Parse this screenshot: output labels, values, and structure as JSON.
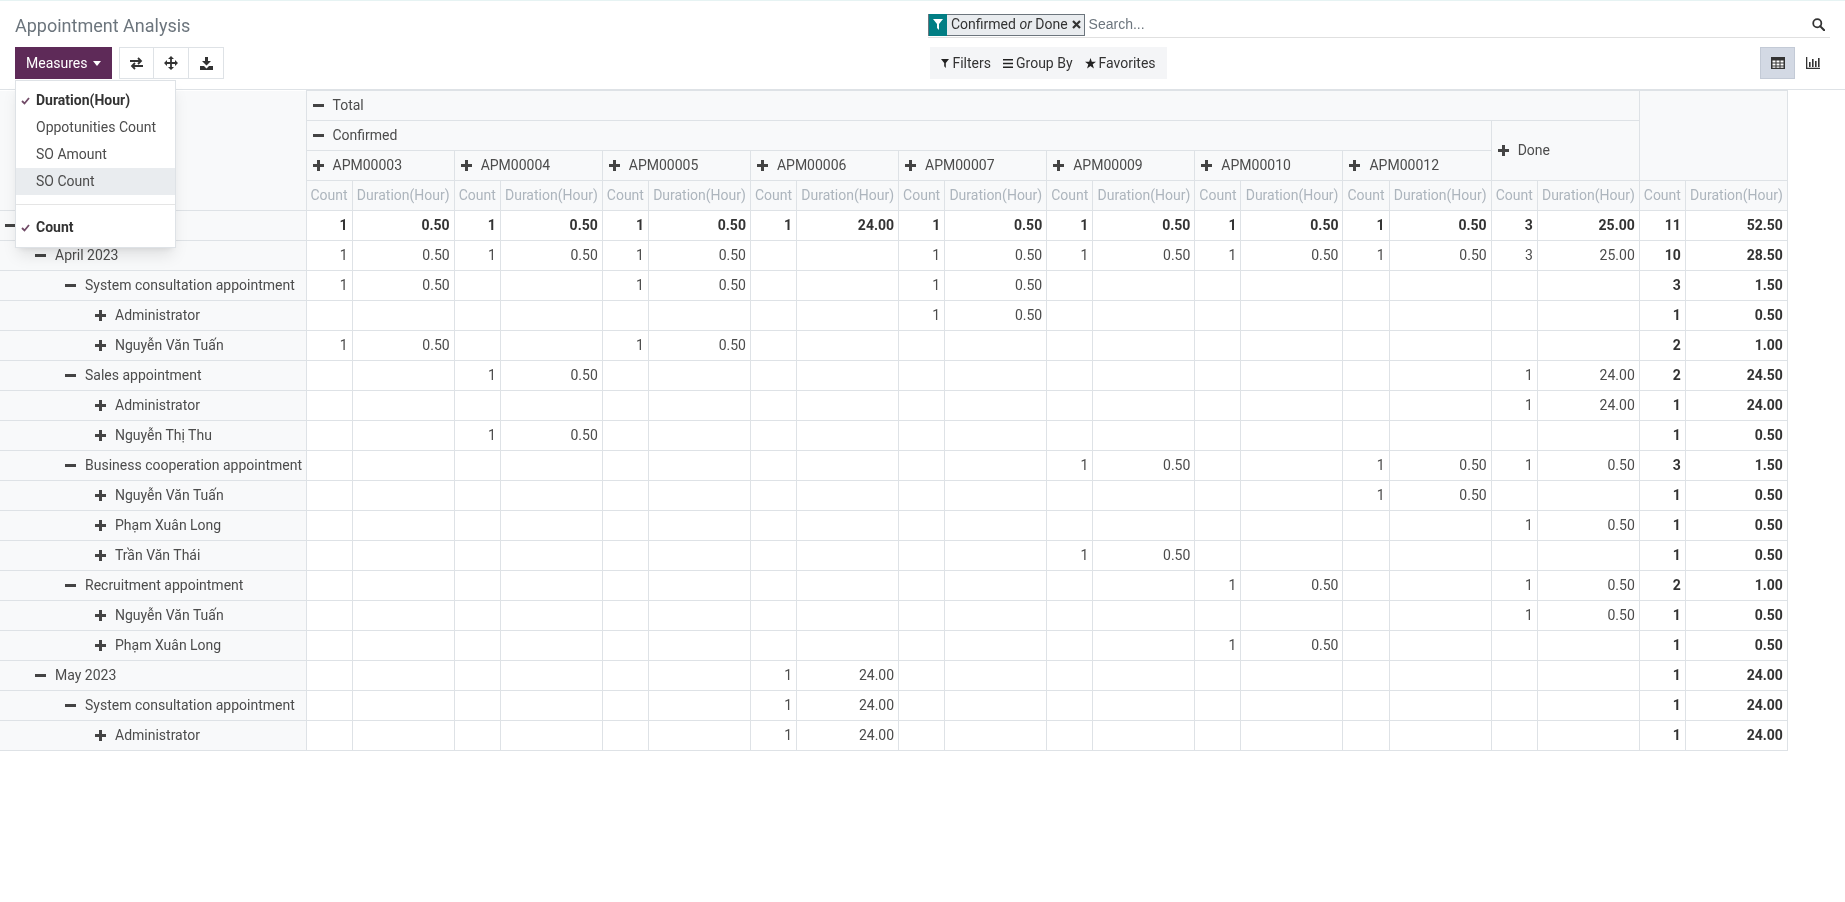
{
  "title": "Appointment Analysis",
  "toolbar": {
    "measures_button": "Measures"
  },
  "measures_menu": [
    {
      "label": "Duration(Hour)",
      "checked": true,
      "hovered": false
    },
    {
      "label": "Oppotunities Count",
      "checked": false,
      "hovered": false
    },
    {
      "label": "SO Amount",
      "checked": false,
      "hovered": false
    },
    {
      "label": "SO Count",
      "checked": false,
      "hovered": true
    },
    {
      "kind": "divider"
    },
    {
      "label": "Count",
      "checked": true,
      "hovered": false
    }
  ],
  "search": {
    "facet": {
      "parts": [
        "Confirmed",
        "or",
        "Done"
      ]
    },
    "placeholder": "Search..."
  },
  "search_options": [
    {
      "kind": "filter",
      "label": "Filters"
    },
    {
      "kind": "group",
      "label": "Group By"
    },
    {
      "kind": "favorite",
      "label": "Favorites"
    }
  ],
  "views": [
    {
      "kind": "pivot",
      "selected": true
    },
    {
      "kind": "graph",
      "selected": false
    }
  ],
  "table": {
    "columns": [
      {
        "label": "Total",
        "expanded": true,
        "children": [
          {
            "label": "Confirmed",
            "expanded": true,
            "children": [
              {
                "label": "APM00003",
                "expanded": false,
                "measures": [
                  "Count",
                  "Duration(Hour)"
                ]
              },
              {
                "label": "APM00004",
                "expanded": false,
                "measures": [
                  "Count",
                  "Duration(Hour)"
                ]
              },
              {
                "label": "APM00005",
                "expanded": false,
                "measures": [
                  "Count",
                  "Duration(Hour)"
                ]
              },
              {
                "label": "APM00006",
                "expanded": false,
                "measures": [
                  "Count",
                  "Duration(Hour)"
                ]
              },
              {
                "label": "APM00007",
                "expanded": false,
                "measures": [
                  "Count",
                  "Duration(Hour)"
                ]
              },
              {
                "label": "APM00009",
                "expanded": false,
                "measures": [
                  "Count",
                  "Duration(Hour)"
                ]
              },
              {
                "label": "APM00010",
                "expanded": false,
                "measures": [
                  "Count",
                  "Duration(Hour)"
                ]
              },
              {
                "label": "APM00012",
                "expanded": false,
                "measures": [
                  "Count",
                  "Duration(Hour)"
                ]
              }
            ]
          },
          {
            "label": "Done",
            "expanded": false,
            "measures": [
              "Count",
              "Duration(Hour)"
            ]
          }
        ]
      }
    ],
    "total_column": {
      "measures": [
        "Count",
        "Duration(Hour)"
      ]
    },
    "rows": [
      {
        "expanded": true,
        "values": {
          "0": [
            "1",
            "0.50"
          ],
          "1": [
            "1",
            "0.50"
          ],
          "2": [
            "1",
            "0.50"
          ],
          "3": [
            "1",
            "24.00"
          ],
          "4": [
            "1",
            "0.50"
          ],
          "5": [
            "1",
            "0.50"
          ],
          "6": [
            "1",
            "0.50"
          ],
          "7": [
            "1",
            "0.50"
          ],
          "8": [
            "3",
            "25.00"
          ],
          "9": [
            "11",
            "52.50"
          ]
        },
        "children": [
          {
            "label": "April 2023",
            "expanded": true,
            "values": {
              "0": [
                "1",
                "0.50"
              ],
              "1": [
                "1",
                "0.50"
              ],
              "2": [
                "1",
                "0.50"
              ],
              "4": [
                "1",
                "0.50"
              ],
              "5": [
                "1",
                "0.50"
              ],
              "6": [
                "1",
                "0.50"
              ],
              "7": [
                "1",
                "0.50"
              ],
              "8": [
                "3",
                "25.00"
              ],
              "9": [
                "10",
                "28.50"
              ]
            },
            "children": [
              {
                "label": "System consultation appointment",
                "expanded": true,
                "values": {
                  "0": [
                    "1",
                    "0.50"
                  ],
                  "2": [
                    "1",
                    "0.50"
                  ],
                  "4": [
                    "1",
                    "0.50"
                  ],
                  "9": [
                    "3",
                    "1.50"
                  ]
                },
                "children": [
                  {
                    "label": "Administrator",
                    "expanded": false,
                    "values": {
                      "4": [
                        "1",
                        "0.50"
                      ],
                      "9": [
                        "1",
                        "0.50"
                      ]
                    }
                  },
                  {
                    "label": "Nguyễn Văn Tuấn",
                    "expanded": false,
                    "values": {
                      "0": [
                        "1",
                        "0.50"
                      ],
                      "2": [
                        "1",
                        "0.50"
                      ],
                      "9": [
                        "2",
                        "1.00"
                      ]
                    }
                  }
                ]
              },
              {
                "label": "Sales appointment",
                "expanded": true,
                "values": {
                  "1": [
                    "1",
                    "0.50"
                  ],
                  "8": [
                    "1",
                    "24.00"
                  ],
                  "9": [
                    "2",
                    "24.50"
                  ]
                },
                "children": [
                  {
                    "label": "Administrator",
                    "expanded": false,
                    "values": {
                      "8": [
                        "1",
                        "24.00"
                      ],
                      "9": [
                        "1",
                        "24.00"
                      ]
                    }
                  },
                  {
                    "label": "Nguyễn Thị Thu",
                    "expanded": false,
                    "values": {
                      "1": [
                        "1",
                        "0.50"
                      ],
                      "9": [
                        "1",
                        "0.50"
                      ]
                    }
                  }
                ]
              },
              {
                "label": "Business cooperation appointment",
                "expanded": true,
                "values": {
                  "5": [
                    "1",
                    "0.50"
                  ],
                  "7": [
                    "1",
                    "0.50"
                  ],
                  "8": [
                    "1",
                    "0.50"
                  ],
                  "9": [
                    "3",
                    "1.50"
                  ]
                },
                "children": [
                  {
                    "label": "Nguyễn Văn Tuấn",
                    "expanded": false,
                    "values": {
                      "7": [
                        "1",
                        "0.50"
                      ],
                      "9": [
                        "1",
                        "0.50"
                      ]
                    }
                  },
                  {
                    "label": "Phạm Xuân Long",
                    "expanded": false,
                    "values": {
                      "8": [
                        "1",
                        "0.50"
                      ],
                      "9": [
                        "1",
                        "0.50"
                      ]
                    }
                  },
                  {
                    "label": "Trần Văn Thái",
                    "expanded": false,
                    "values": {
                      "5": [
                        "1",
                        "0.50"
                      ],
                      "9": [
                        "1",
                        "0.50"
                      ]
                    }
                  }
                ]
              },
              {
                "label": "Recruitment appointment",
                "expanded": true,
                "values": {
                  "6": [
                    "1",
                    "0.50"
                  ],
                  "8": [
                    "1",
                    "0.50"
                  ],
                  "9": [
                    "2",
                    "1.00"
                  ]
                },
                "children": [
                  {
                    "label": "Nguyễn Văn Tuấn",
                    "expanded": false,
                    "values": {
                      "8": [
                        "1",
                        "0.50"
                      ],
                      "9": [
                        "1",
                        "0.50"
                      ]
                    }
                  },
                  {
                    "label": "Phạm Xuân Long",
                    "expanded": false,
                    "values": {
                      "6": [
                        "1",
                        "0.50"
                      ],
                      "9": [
                        "1",
                        "0.50"
                      ]
                    }
                  }
                ]
              }
            ]
          },
          {
            "label": "May 2023",
            "expanded": true,
            "values": {
              "3": [
                "1",
                "24.00"
              ],
              "9": [
                "1",
                "24.00"
              ]
            },
            "children": [
              {
                "label": "System consultation appointment",
                "expanded": true,
                "values": {
                  "3": [
                    "1",
                    "24.00"
                  ],
                  "9": [
                    "1",
                    "24.00"
                  ]
                },
                "children": [
                  {
                    "label": "Administrator",
                    "expanded": false,
                    "values": {
                      "3": [
                        "1",
                        "24.00"
                      ],
                      "9": [
                        "1",
                        "24.00"
                      ]
                    }
                  }
                ]
              }
            ]
          }
        ]
      }
    ]
  }
}
